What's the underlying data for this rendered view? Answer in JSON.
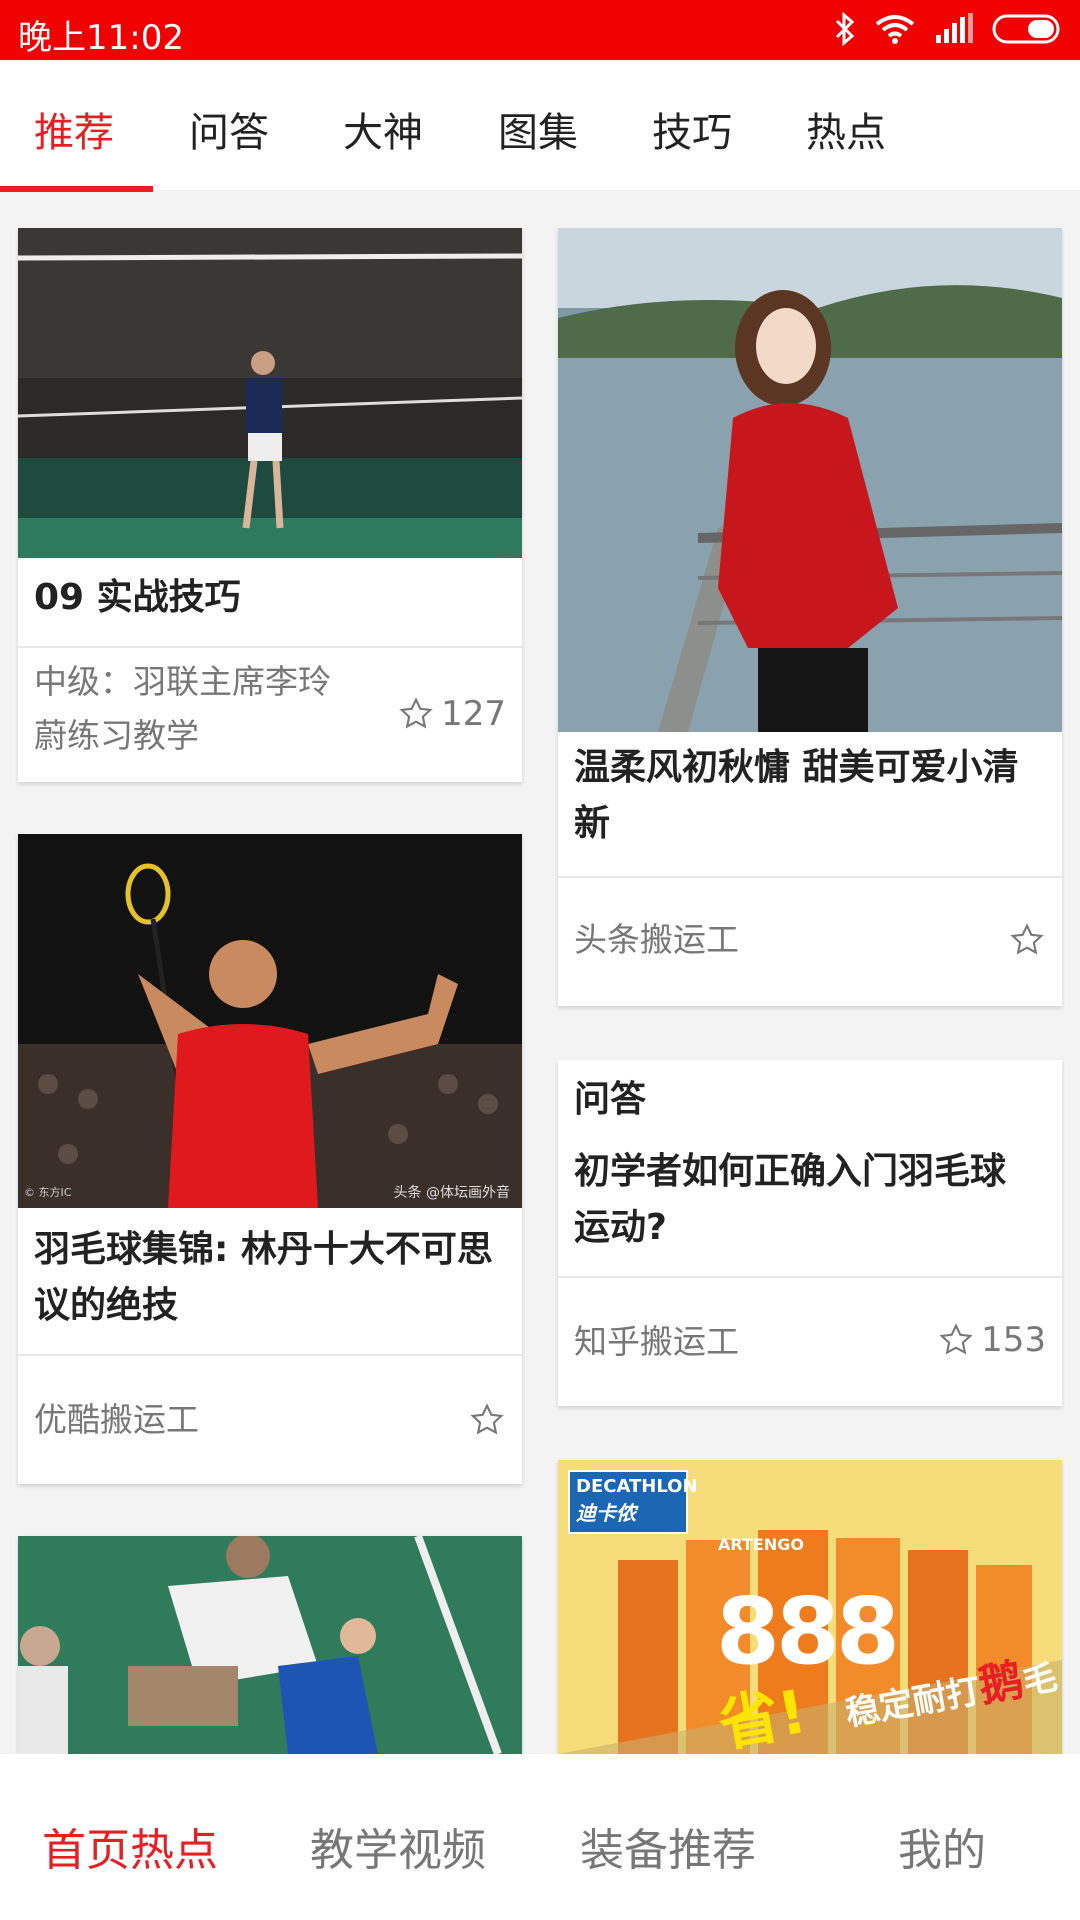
{
  "status_bar": {
    "time": "晚上11:02",
    "icons": [
      "bluetooth-icon",
      "wifi-icon",
      "signal-icon",
      "battery-icon"
    ]
  },
  "tabs": [
    {
      "label": "推荐",
      "active": true
    },
    {
      "label": "问答",
      "active": false
    },
    {
      "label": "大神",
      "active": false
    },
    {
      "label": "图集",
      "active": false
    },
    {
      "label": "技巧",
      "active": false
    },
    {
      "label": "热点",
      "active": false
    }
  ],
  "cards": {
    "c1": {
      "title": "09 实战技巧",
      "subtitle_line1": "中级：羽联主席李玲",
      "subtitle_line2": "蔚练习教学",
      "fav_count": "127"
    },
    "c2": {
      "title_line1": "温柔风初秋慵 甜美可爱小清",
      "title_line2": "新",
      "source": "头条搬运工"
    },
    "c3": {
      "title_line1": "羽毛球集锦: 林丹十大不可思",
      "title_line2": "议的绝技",
      "source": "优酷搬运工",
      "watermark_left": "© 东方IC",
      "watermark_right": "头条 @体坛画外音"
    },
    "c4": {
      "category": "问答",
      "title_line1": "初学者如何正确入门羽毛球",
      "title_line2": "运动?",
      "source": "知乎搬运工",
      "fav_count": "153"
    },
    "c6": {
      "brand": "DECATHLON",
      "brand_cn": "迪卡侬",
      "product": "ARTENGO",
      "big_number": "888",
      "slogan_1": "省!",
      "slogan_2": "稳定耐打",
      "slogan_3": "鹅",
      "slogan_4": "毛"
    }
  },
  "bottom_nav": [
    {
      "label": "首页热点",
      "active": true
    },
    {
      "label": "教学视频",
      "active": false
    },
    {
      "label": "装备推荐",
      "active": false
    },
    {
      "label": "我的",
      "active": false
    }
  ],
  "colors": {
    "accent": "#e81e25",
    "status_bar": "#f10000"
  }
}
